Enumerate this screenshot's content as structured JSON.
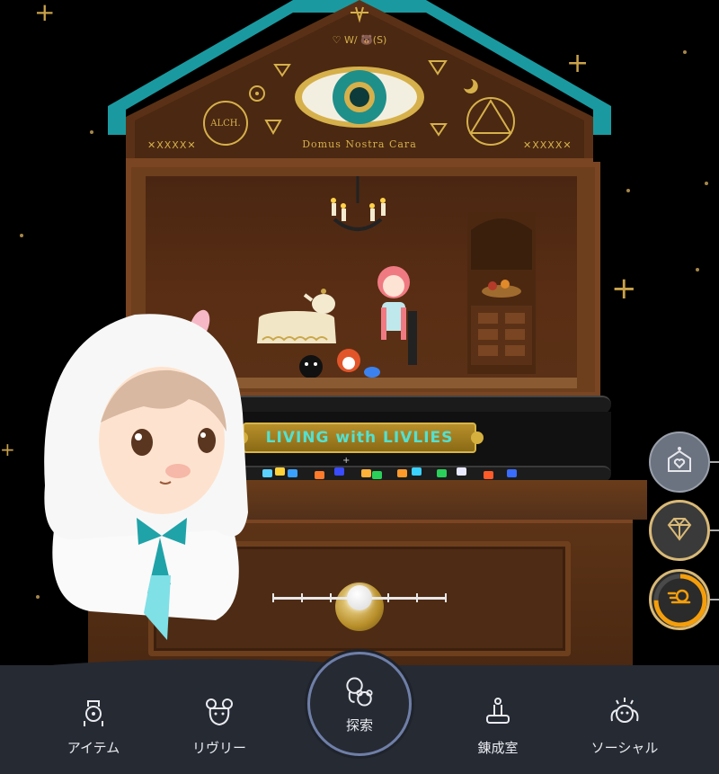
{
  "scene": {
    "roof": {
      "motto": "♡ W/ 🐻(S)",
      "caption": "Domus Nostra Cara",
      "left_marks": "✕XXXX✕",
      "right_marks": "✕XXXX✕",
      "seal": "ALCH."
    },
    "sign": {
      "text": "LIVING with LIVLIES"
    },
    "colors": {
      "teal_roof": "#1a9aa0",
      "wood": "#6e3f1d",
      "gold": "#d6b04a",
      "sign_text": "#53e0d0"
    }
  },
  "side_buttons": [
    {
      "icon": "house-heart-icon",
      "state": "inactive"
    },
    {
      "icon": "diamond-icon",
      "state": "active"
    },
    {
      "icon": "speed-gauge-icon",
      "state": "active",
      "ring_fill": 0.75
    }
  ],
  "nav": {
    "items": [
      {
        "label": "アイテム",
        "icon": "item-icon"
      },
      {
        "label": "リヴリー",
        "icon": "livly-icon"
      },
      {
        "label": "探索",
        "icon": "explore-icon",
        "selected": true
      },
      {
        "label": "錬成室",
        "icon": "alchemy-room-icon"
      },
      {
        "label": "ソーシャル",
        "icon": "social-icon"
      }
    ]
  },
  "slider": {
    "ticks": 7,
    "value": 0.5
  }
}
